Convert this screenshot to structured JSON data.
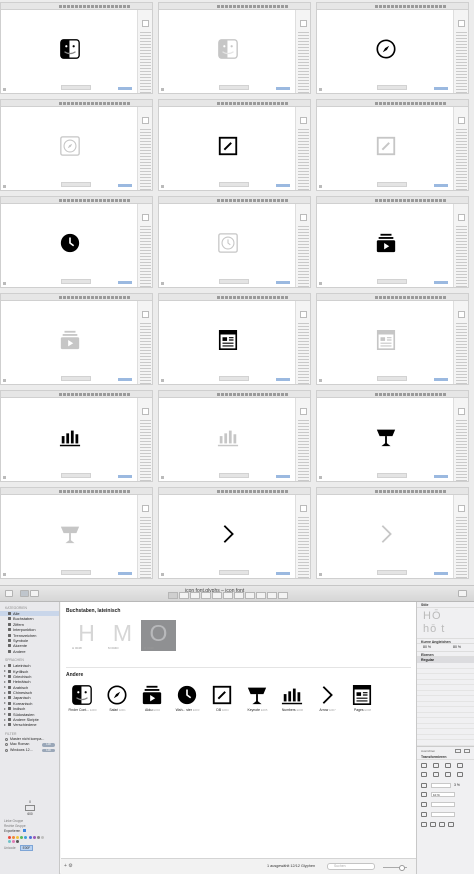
{
  "window": {
    "title": "icon font.glyphs – icon font"
  },
  "sidebar": {
    "categories_heading": "KATEGORIEN",
    "categories": [
      {
        "label": "Alle",
        "selected": true
      },
      {
        "label": "Buchstaben"
      },
      {
        "label": "Ziffern"
      },
      {
        "label": "Interpunktion"
      },
      {
        "label": "Trennzeichen"
      },
      {
        "label": "Symbole"
      },
      {
        "label": "Akzente"
      },
      {
        "label": "Andere"
      }
    ],
    "languages_heading": "SPRACHEN",
    "languages": [
      {
        "label": "Lateinisch"
      },
      {
        "label": "Kyrillisch"
      },
      {
        "label": "Griechisch"
      },
      {
        "label": "Hebräisch"
      },
      {
        "label": "Arabisch"
      },
      {
        "label": "Chinesisch"
      },
      {
        "label": "Japanisch"
      },
      {
        "label": "Koreanisch"
      },
      {
        "label": "Indisch"
      },
      {
        "label": "Südostasien"
      },
      {
        "label": "Andere Skripte"
      },
      {
        "label": "Verschiedene"
      }
    ],
    "filter_heading": "FILTER",
    "filters": [
      {
        "label": "Master nicht kompa..."
      },
      {
        "label": "Mac Roman",
        "badge": "14/0"
      },
      {
        "label": "Windows 12...",
        "badge": "14/0"
      }
    ],
    "bottom": {
      "width_value": "0",
      "advance_value": "600",
      "left_group_label": "Linke Gruppe",
      "right_group_label": "Rechte Gruppe",
      "export_label": "Exportieren",
      "unicode_label": "Unicode",
      "unicode_value": "E00F"
    },
    "color_dots": [
      "#e8493f",
      "#f08a36",
      "#f3c53b",
      "#5cb85c",
      "#3da1d8",
      "#4e6fd8",
      "#9b59b6",
      "#888888",
      "#c0c0c0",
      "#6ec3c9",
      "#e07bb4",
      "#555555"
    ]
  },
  "main": {
    "latin_heading": "Buchstaben, lateinisch",
    "latin_glyphs": [
      {
        "char": "H",
        "code": "0048"
      },
      {
        "char": "M",
        "code": "004D"
      },
      {
        "char": "O",
        "code": "004F",
        "selected": true
      }
    ],
    "other_heading": "Andere",
    "other_glyphs": [
      {
        "name": "Finder Cont...",
        "code": "E000",
        "icon": "finder-icon"
      },
      {
        "name": "Safari",
        "code": "E001",
        "icon": "compass-icon"
      },
      {
        "name": "Akku",
        "code": "E002",
        "icon": "video-stack-icon"
      },
      {
        "name": "Wah... ster",
        "code": "E003",
        "icon": "clock-icon"
      },
      {
        "name": "DB",
        "code": "E004",
        "icon": "pencil-square-icon"
      },
      {
        "name": "Keynote",
        "code": "E005",
        "icon": "podium-icon"
      },
      {
        "name": "Numbers",
        "code": "E006",
        "icon": "bar-chart-icon"
      },
      {
        "name": "Arrow",
        "code": "E007",
        "icon": "chevron-right-icon"
      },
      {
        "name": "Pages",
        "code": "E008",
        "icon": "document-icon"
      }
    ]
  },
  "status": {
    "count_text": "1 ausgewählt 12/12 Glyphen",
    "search_placeholder": "Suchen"
  },
  "inspector": {
    "style_heading": "Stile",
    "curve_heading": "Kurve Angleichen",
    "percent_left": "80 %",
    "percent_right": "80 %",
    "instances_heading": "Ebenen",
    "instance_regular": "Regular",
    "transform_heading": "Transformieren",
    "anchor_label": "Ausrichten",
    "scale_value": "3 %",
    "rotate_value": "10 %"
  },
  "frames": [
    {
      "icon": "finder-icon",
      "faint": false
    },
    {
      "icon": "finder-icon",
      "faint": true
    },
    {
      "icon": "compass-icon",
      "faint": false
    },
    {
      "icon": "compass-square-icon",
      "faint": true
    },
    {
      "icon": "pencil-square-icon",
      "faint": false
    },
    {
      "icon": "pencil-square-icon",
      "faint": true
    },
    {
      "icon": "clock-icon",
      "faint": false
    },
    {
      "icon": "clock-square-icon",
      "faint": true
    },
    {
      "icon": "video-stack-icon",
      "faint": false
    },
    {
      "icon": "video-stack-icon",
      "faint": true
    },
    {
      "icon": "document-icon",
      "faint": false
    },
    {
      "icon": "document-icon",
      "faint": true
    },
    {
      "icon": "bar-chart-icon",
      "faint": false
    },
    {
      "icon": "bar-chart-icon",
      "faint": true
    },
    {
      "icon": "podium-icon",
      "faint": false
    },
    {
      "icon": "podium-icon",
      "faint": true
    },
    {
      "icon": "chevron-right-icon",
      "faint": false
    },
    {
      "icon": "chevron-right-icon",
      "faint": true
    }
  ]
}
